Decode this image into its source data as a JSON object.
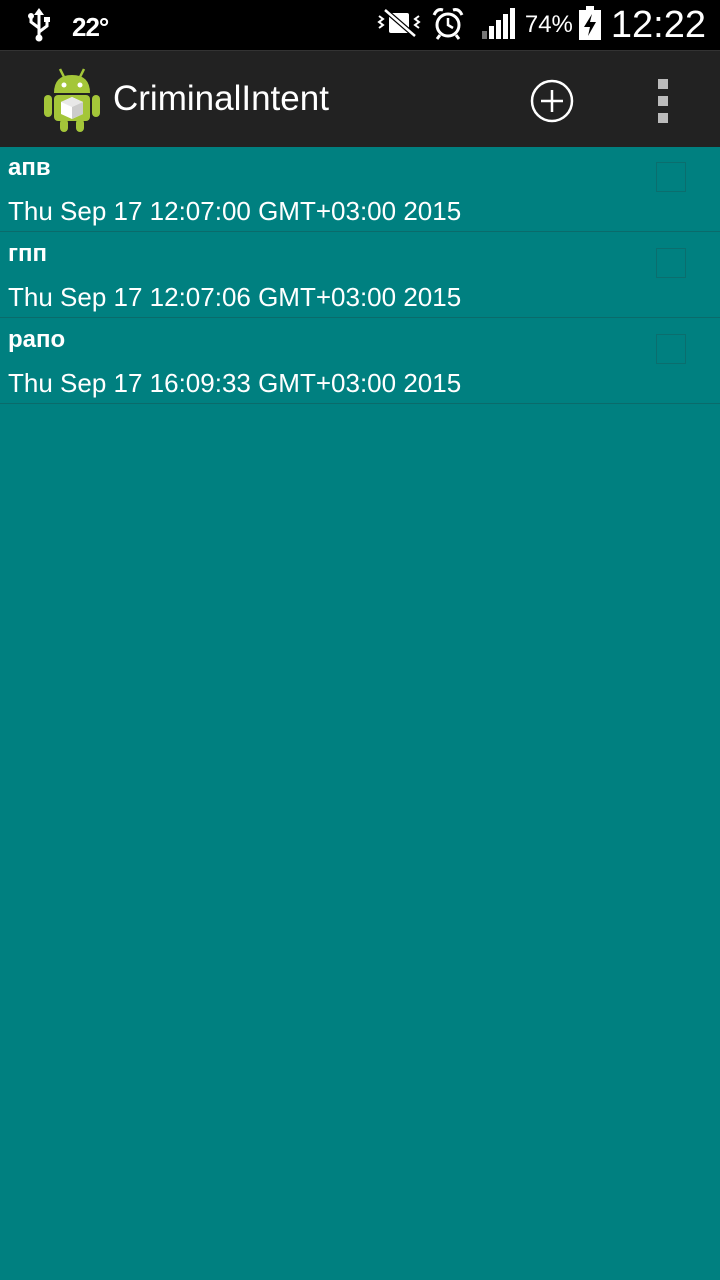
{
  "status_bar": {
    "icons": [
      "usb-icon",
      "mute-vibrate-icon",
      "alarm-icon",
      "signal-icon",
      "battery-charging-icon"
    ],
    "temperature": "22°",
    "battery_percent": "74%",
    "time": "12:22"
  },
  "action_bar": {
    "title": "CriminalIntent",
    "icons": [
      "android-app-icon",
      "add-circle-icon",
      "overflow-menu-icon"
    ]
  },
  "crimes": [
    {
      "title": "апв",
      "date": "Thu Sep 17 12:07:00 GMT+03:00 2015",
      "solved": false
    },
    {
      "title": "гпп",
      "date": "Thu Sep 17 12:07:06 GMT+03:00 2015",
      "solved": false
    },
    {
      "title": "рапо",
      "date": "Thu Sep 17 16:09:33 GMT+03:00 2015",
      "solved": false
    }
  ],
  "colors": {
    "background": "#008080",
    "action_bar": "#222222",
    "status_bar": "#000000",
    "text": "#ffffff"
  }
}
